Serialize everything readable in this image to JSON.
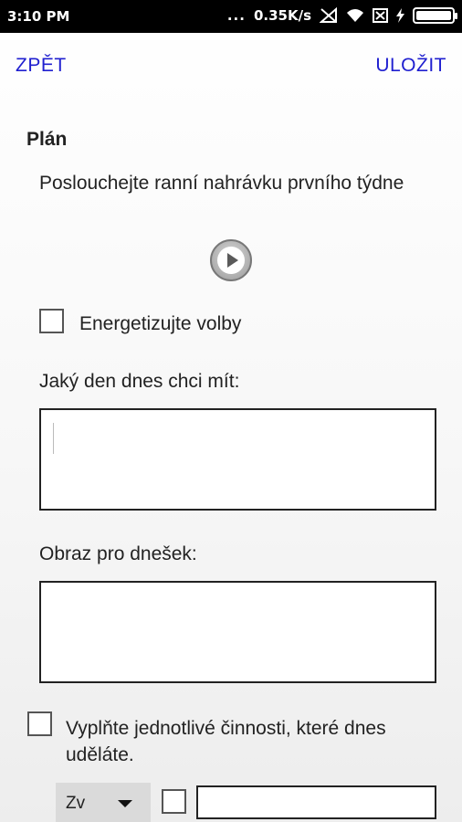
{
  "status_bar": {
    "time": "3:10 PM",
    "dots": "...",
    "speed": "0.35K/s",
    "icons": [
      "signal-off-icon",
      "wifi-icon",
      "sim-off-icon",
      "charging-icon",
      "battery-icon"
    ],
    "battery_level": 1.0
  },
  "toolbar": {
    "back_label": "ZPĚT",
    "save_label": "ULOŽIT"
  },
  "plan": {
    "title": "Plán",
    "instruction": "Poslouchejte ranní nahrávku prvního týdne",
    "play_icon": "play-icon",
    "energize_label": "Energetizujte volby",
    "energize_checked": false,
    "day_question": "Jaký den dnes chci mít:",
    "day_value": "",
    "image_label": "Obraz pro dnešek:",
    "image_value": "",
    "activities_label": "Vyplňte jednotlivé činnosti, které dnes uděláte.",
    "activities_checked": false,
    "activity_row": {
      "dropdown_value": "Zv",
      "checked": false,
      "text": ""
    }
  },
  "colors": {
    "action": "#2020d0",
    "status_bar": "#000000"
  }
}
